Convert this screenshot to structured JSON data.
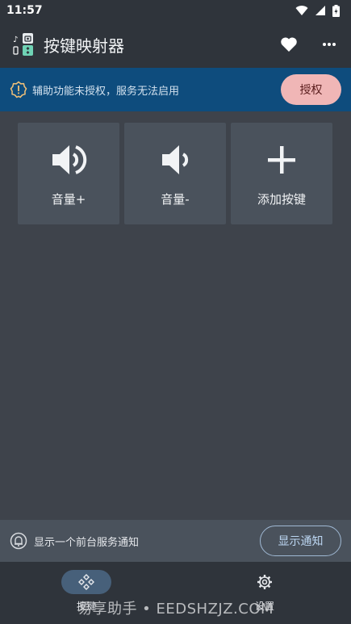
{
  "status_bar": {
    "time": "11:57"
  },
  "app_bar": {
    "title": "按键映射器"
  },
  "notice": {
    "text": "辅助功能未授权，服务无法启用",
    "button": "授权"
  },
  "tiles": [
    {
      "label": "音量+",
      "icon": "volume-up-icon"
    },
    {
      "label": "音量-",
      "icon": "volume-down-icon"
    },
    {
      "label": "添加按键",
      "icon": "plus-icon"
    }
  ],
  "foreground_notice": {
    "text": "显示一个前台服务通知",
    "button": "显示通知"
  },
  "bottom_nav": [
    {
      "label": "按键",
      "icon": "gamepad-icon",
      "active": true
    },
    {
      "label": "设置",
      "icon": "gear-icon",
      "active": false
    }
  ],
  "watermark": "易享助手 • EEDSHZJZ.COM",
  "colors": {
    "background": "#3e434b",
    "app_bar": "#2f343b",
    "notice_bar": "#0e4c7d",
    "auth_button": "#f0b6b6",
    "tile": "#4a525c",
    "nav_active": "#47607a"
  }
}
